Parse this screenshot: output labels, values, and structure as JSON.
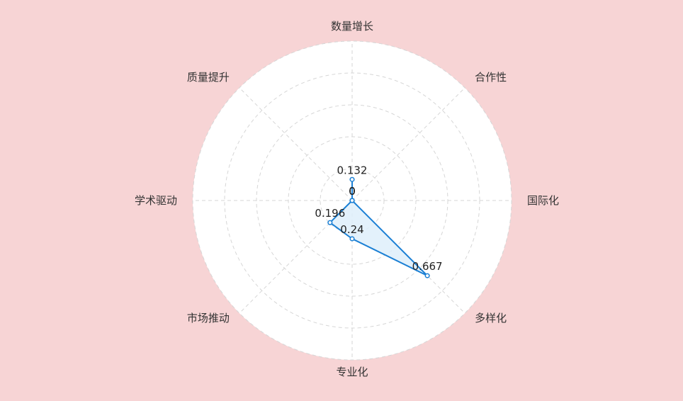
{
  "chart_data": {
    "type": "radar",
    "axes": [
      "数量增长",
      "合作性",
      "国际化",
      "多样化",
      "专业化",
      "市场推动",
      "学术驱动",
      "质量提升"
    ],
    "series": [
      {
        "values": [
          0.132,
          0,
          0,
          0.667,
          0.24,
          0.196,
          0,
          0
        ]
      }
    ],
    "value_labels": [
      "0.132",
      "0",
      "0",
      "0.667",
      "0.24",
      "0.196",
      "0",
      "0"
    ],
    "range": [
      0,
      1
    ],
    "ring_count": 5,
    "grid": true,
    "colors": {
      "background": "#f7d4d5",
      "plot_area": "#ffffff",
      "line": "#1a7fd4",
      "fill": "#deeefa",
      "grid": "#d6d6d6"
    }
  }
}
